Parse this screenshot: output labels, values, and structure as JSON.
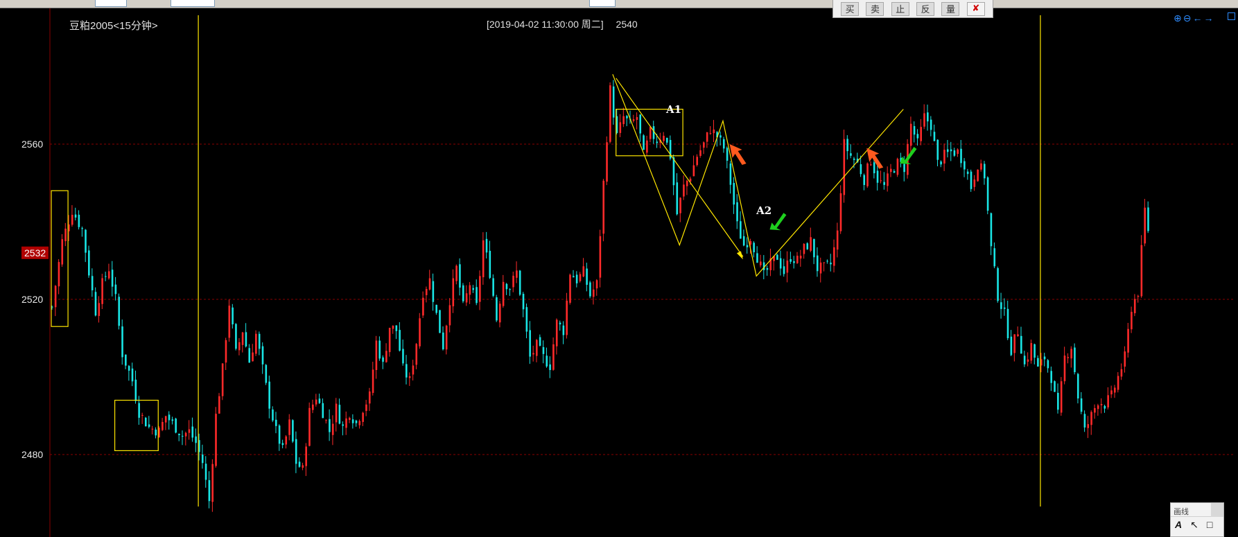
{
  "toolbar": {
    "trade_buttons": [
      "买",
      "卖",
      "止",
      "反",
      "量"
    ],
    "close_icon": "cancel-icon"
  },
  "header": {
    "symbol": "豆粕2005<15分钟>",
    "cursor_datetime": "[2019-04-02  11:30:00 周二]",
    "cursor_price": "2540"
  },
  "zoom_tools": [
    "zoom-in-icon",
    "zoom-out-icon",
    "scroll-left-icon",
    "scroll-right-icon"
  ],
  "draw_panel": {
    "title": "画线",
    "tools": [
      "A",
      "↖",
      "□"
    ]
  },
  "colors": {
    "up": "#ff2a2a",
    "down": "#19e6e6",
    "drawing": "#ffe600",
    "grid": "#8b0000",
    "axis_text": "#e8e8e8",
    "price_tag_bg": "#b00000",
    "sell_arrow": "#ff5a1e",
    "buy_arrow": "#1ecf1e"
  },
  "chart_data": {
    "type": "candlestick",
    "title": "豆粕2005<15分钟>",
    "ylim": [
      2466,
      2582
    ],
    "yticks": [
      2480,
      2520,
      2560
    ],
    "current_price_tag": 2532,
    "grid": true,
    "close_path": [
      [
        0,
        2518
      ],
      [
        3,
        2535
      ],
      [
        6,
        2543
      ],
      [
        9,
        2538
      ],
      [
        11,
        2527
      ],
      [
        13,
        2517
      ],
      [
        15,
        2524
      ],
      [
        17,
        2528
      ],
      [
        19,
        2520
      ],
      [
        21,
        2506
      ],
      [
        24,
        2499
      ],
      [
        26,
        2491
      ],
      [
        29,
        2487
      ],
      [
        32,
        2486
      ],
      [
        34,
        2490
      ],
      [
        37,
        2487
      ],
      [
        39,
        2485
      ],
      [
        41,
        2486
      ],
      [
        43,
        2483
      ],
      [
        45,
        2478
      ],
      [
        47,
        2468
      ],
      [
        49,
        2490
      ],
      [
        51,
        2502
      ],
      [
        53,
        2519
      ],
      [
        55,
        2506
      ],
      [
        57,
        2512
      ],
      [
        59,
        2504
      ],
      [
        61,
        2511
      ],
      [
        63,
        2502
      ],
      [
        65,
        2493
      ],
      [
        67,
        2486
      ],
      [
        69,
        2481
      ],
      [
        71,
        2488
      ],
      [
        73,
        2478
      ],
      [
        75,
        2476
      ],
      [
        77,
        2491
      ],
      [
        79,
        2495
      ],
      [
        81,
        2491
      ],
      [
        83,
        2486
      ],
      [
        85,
        2492
      ],
      [
        87,
        2487
      ],
      [
        89,
        2491
      ],
      [
        91,
        2488
      ],
      [
        93,
        2492
      ],
      [
        95,
        2495
      ],
      [
        97,
        2509
      ],
      [
        99,
        2503
      ],
      [
        101,
        2513
      ],
      [
        103,
        2512
      ],
      [
        105,
        2502
      ],
      [
        107,
        2499
      ],
      [
        109,
        2509
      ],
      [
        111,
        2522
      ],
      [
        113,
        2525
      ],
      [
        115,
        2516
      ],
      [
        117,
        2508
      ],
      [
        119,
        2520
      ],
      [
        121,
        2528
      ],
      [
        123,
        2518
      ],
      [
        125,
        2524
      ],
      [
        127,
        2518
      ],
      [
        129,
        2535
      ],
      [
        131,
        2527
      ],
      [
        133,
        2515
      ],
      [
        135,
        2525
      ],
      [
        137,
        2523
      ],
      [
        139,
        2527
      ],
      [
        141,
        2517
      ],
      [
        143,
        2505
      ],
      [
        145,
        2508
      ],
      [
        147,
        2505
      ],
      [
        149,
        2503
      ],
      [
        151,
        2514
      ],
      [
        153,
        2512
      ],
      [
        155,
        2527
      ],
      [
        157,
        2525
      ],
      [
        159,
        2527
      ],
      [
        161,
        2521
      ],
      [
        163,
        2524
      ],
      [
        165,
        2550
      ],
      [
        167,
        2574
      ],
      [
        169,
        2562
      ],
      [
        171,
        2567
      ],
      [
        173,
        2565
      ],
      [
        175,
        2567
      ],
      [
        177,
        2557
      ],
      [
        179,
        2563
      ],
      [
        181,
        2561
      ],
      [
        183,
        2563
      ],
      [
        185,
        2557
      ],
      [
        187,
        2542
      ],
      [
        189,
        2549
      ],
      [
        191,
        2552
      ],
      [
        193,
        2557
      ],
      [
        195,
        2560
      ],
      [
        197,
        2564
      ],
      [
        199,
        2562
      ],
      [
        201,
        2559
      ],
      [
        203,
        2550
      ],
      [
        205,
        2539
      ],
      [
        207,
        2534
      ],
      [
        209,
        2536
      ],
      [
        211,
        2531
      ],
      [
        213,
        2526
      ],
      [
        215,
        2529
      ],
      [
        217,
        2531
      ],
      [
        219,
        2527
      ],
      [
        221,
        2531
      ],
      [
        223,
        2530
      ],
      [
        225,
        2533
      ],
      [
        227,
        2535
      ],
      [
        229,
        2528
      ],
      [
        231,
        2528
      ],
      [
        233,
        2529
      ],
      [
        235,
        2537
      ],
      [
        237,
        2560
      ],
      [
        239,
        2557
      ],
      [
        241,
        2555
      ],
      [
        243,
        2551
      ],
      [
        245,
        2556
      ],
      [
        247,
        2551
      ],
      [
        249,
        2549
      ],
      [
        251,
        2553
      ],
      [
        253,
        2555
      ],
      [
        255,
        2554
      ],
      [
        257,
        2565
      ],
      [
        259,
        2560
      ],
      [
        261,
        2567
      ],
      [
        263,
        2565
      ],
      [
        265,
        2555
      ],
      [
        267,
        2557
      ],
      [
        269,
        2558
      ],
      [
        271,
        2558
      ],
      [
        273,
        2555
      ],
      [
        275,
        2549
      ],
      [
        277,
        2555
      ],
      [
        279,
        2552
      ],
      [
        281,
        2533
      ],
      [
        283,
        2521
      ],
      [
        285,
        2516
      ],
      [
        287,
        2507
      ],
      [
        289,
        2512
      ],
      [
        291,
        2503
      ],
      [
        293,
        2508
      ],
      [
        295,
        2502
      ],
      [
        297,
        2505
      ],
      [
        299,
        2500
      ],
      [
        301,
        2490
      ],
      [
        303,
        2505
      ],
      [
        305,
        2508
      ],
      [
        307,
        2495
      ],
      [
        309,
        2486
      ],
      [
        311,
        2490
      ],
      [
        313,
        2494
      ],
      [
        315,
        2493
      ],
      [
        317,
        2495
      ],
      [
        319,
        2500
      ],
      [
        321,
        2505
      ],
      [
        323,
        2518
      ],
      [
        325,
        2522
      ],
      [
        327,
        2543
      ],
      [
        328,
        2538
      ]
    ],
    "vertical_markers": [
      44,
      296
    ],
    "annotations": [
      {
        "label": "A1",
        "price": 2568,
        "bar": 184
      },
      {
        "label": "A2",
        "price": 2542,
        "bar": 211
      }
    ],
    "signals": [
      {
        "type": "sell",
        "bar": 203,
        "price": 2560
      },
      {
        "type": "buy",
        "bar": 215,
        "price": 2538
      },
      {
        "type": "sell",
        "bar": 244,
        "price": 2559
      },
      {
        "type": "buy",
        "bar": 254,
        "price": 2555
      }
    ],
    "boxes": [
      {
        "bars": [
          0,
          5
        ],
        "price_low": 2513,
        "price_high": 2548
      },
      {
        "bars": [
          19,
          32
        ],
        "price_low": 2481,
        "price_high": 2494
      },
      {
        "bars": [
          169,
          189
        ],
        "price_low": 2557,
        "price_high": 2569
      }
    ],
    "trendlines": [
      {
        "from": [
          169,
          2577
        ],
        "to": [
          207,
          2531
        ]
      },
      {
        "from": [
          168,
          2578
        ],
        "to": [
          188,
          2534
        ],
        "to2": [
          201,
          2566
        ],
        "to3": [
          211,
          2526
        ],
        "to4": [
          255,
          2569
        ]
      }
    ]
  }
}
